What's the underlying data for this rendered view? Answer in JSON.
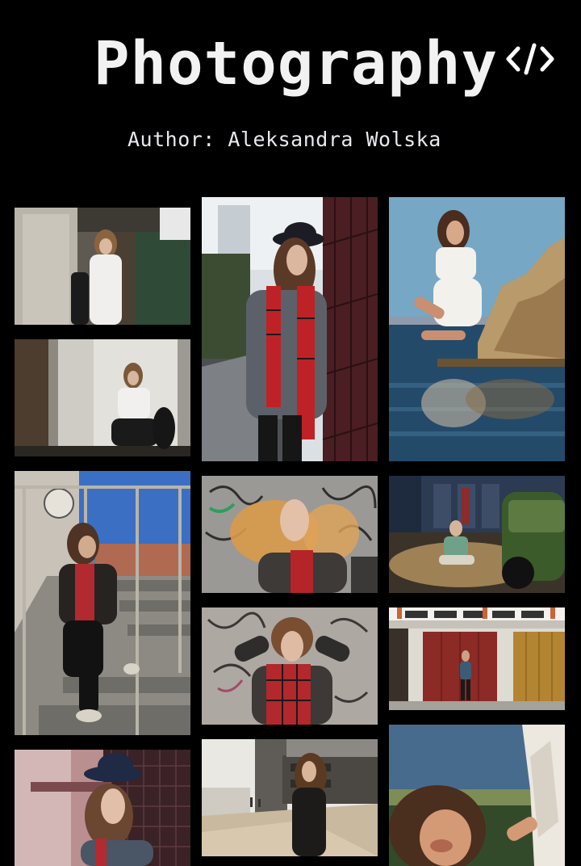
{
  "header": {
    "title": "Photography",
    "code_icon_text": "</>",
    "author": "Author: Aleksandra Wolska"
  },
  "gallery": {
    "photos": [
      {
        "id": "p1",
        "scene": "girl in white shirt against weathered garage doors"
      },
      {
        "id": "p2",
        "scene": "girl in hat and red tartan scarf by a fence"
      },
      {
        "id": "p3",
        "scene": "girl in white dress sitting on rocks by the water"
      },
      {
        "id": "p4",
        "scene": "girl crouching in front of white door"
      },
      {
        "id": "p5",
        "scene": "girl sitting on stairs behind railing"
      },
      {
        "id": "p6",
        "scene": "girl with windblown hair in front of graffiti"
      },
      {
        "id": "p7",
        "scene": "girl sitting on the ground near a green car"
      },
      {
        "id": "p8",
        "scene": "girl with hands in hair in front of graffiti"
      },
      {
        "id": "p9",
        "scene": "girl standing in front of red and yellow garage doors"
      },
      {
        "id": "p10",
        "scene": "girl in hat in front of a grid fence"
      },
      {
        "id": "p11",
        "scene": "girl walking down a city sidewalk"
      },
      {
        "id": "p12",
        "scene": "girl with sunlit face by a white curtain"
      }
    ]
  }
}
